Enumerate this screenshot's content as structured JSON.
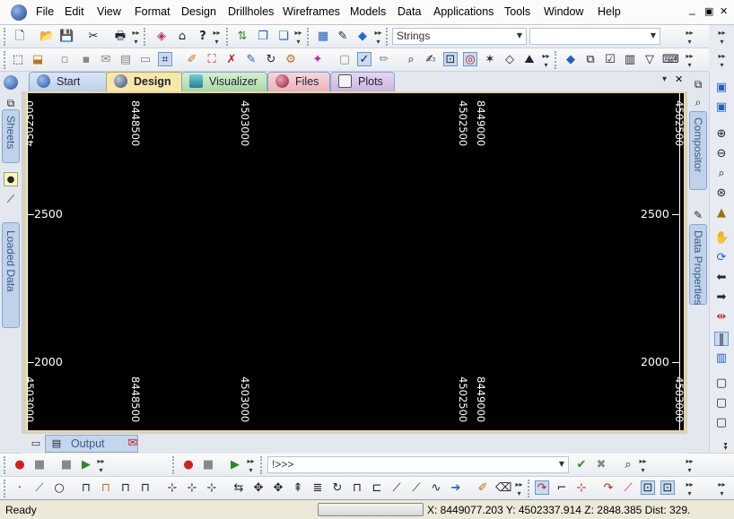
{
  "menu": {
    "items": [
      "File",
      "Edit",
      "View",
      "Format",
      "Design",
      "Drillholes",
      "Wireframes",
      "Models",
      "Data",
      "Applications",
      "Tools",
      "Window",
      "Help"
    ],
    "minimize": "_",
    "restore": "▣",
    "close": "✕"
  },
  "toolbar": {
    "strings_combo": "Strings",
    "command_prompt": "!>>>"
  },
  "tabs": [
    "Start",
    "Design",
    "Visualizer",
    "Files",
    "Plots"
  ],
  "tabs_close": "✕",
  "left_panel": {
    "sheets": "Sheets",
    "loaded_data": "Loaded Data"
  },
  "right_panel": {
    "compositor": "Compositor",
    "data_properties": "Data Properties"
  },
  "viewport": {
    "y_labels": [
      "2500",
      "2000"
    ],
    "top_labels": [
      "4502500",
      "8448500",
      "4503000",
      "4502500",
      "8449000",
      "4502500"
    ],
    "bottom_labels": [
      "4503000",
      "8448500",
      "4503000",
      "4502500",
      "8449000",
      "4503000"
    ]
  },
  "output_tab": "Output",
  "status": {
    "ready": "Ready",
    "coords": "X: 8449077.203  Y: 4502337.914  Z: 2848.385  Dist: 329."
  },
  "colors": {
    "viewport_bg": "#000000",
    "viewport_border": "#e8d79a",
    "active_tab": "#f7e8a8",
    "grid_label": "#ffffff"
  }
}
